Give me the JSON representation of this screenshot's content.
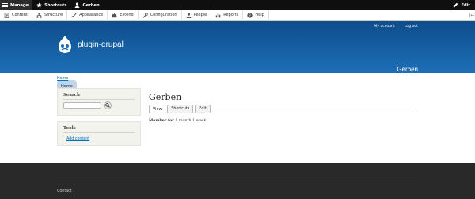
{
  "toolbar": {
    "manage": "Manage",
    "shortcuts": "Shortcuts",
    "user": "Gerben",
    "edit": "Edit"
  },
  "tray": {
    "items": [
      "Content",
      "Structure",
      "Appearance",
      "Extend",
      "Configuration",
      "People",
      "Reports",
      "Help"
    ]
  },
  "header": {
    "site_name": "plugin-drupal",
    "secondary_menu": [
      "My account",
      "Log out"
    ],
    "user_name": "Gerben",
    "home_tab": "Home"
  },
  "breadcrumb": "Home",
  "sidebar": {
    "search_title": "Search",
    "search_value": "",
    "tools_title": "Tools",
    "tools_link": "Add content"
  },
  "main": {
    "title": "Gerben",
    "tabs": [
      "View",
      "Shortcuts",
      "Edit"
    ],
    "member_label": "Member for",
    "member_value": "1 month 1 week"
  },
  "footer": {
    "link": "Contact"
  },
  "colors": {
    "header_top": "#0d4d8a",
    "header_bottom": "#1e6fb8",
    "toolbar": "#0f0f0f",
    "link": "#0071b8",
    "footer": "#292929"
  }
}
